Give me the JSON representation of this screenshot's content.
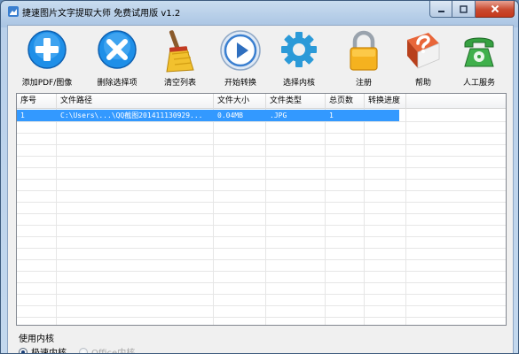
{
  "window": {
    "title": "捷速图片文字提取大师 免费试用版 v1.2",
    "controls": {
      "minimize": "─",
      "maximize": "□",
      "close": "✕"
    }
  },
  "toolbar": {
    "items": [
      {
        "id": "add",
        "label": "添加PDF/图像",
        "icon": "plus-circle-icon",
        "color": "#1e90ff"
      },
      {
        "id": "delete",
        "label": "删除选择项",
        "icon": "x-circle-icon",
        "color": "#1e90ff"
      },
      {
        "id": "clear",
        "label": "清空列表",
        "icon": "broom-icon",
        "color": "#e0b020"
      },
      {
        "id": "start",
        "label": "开始转换",
        "icon": "play-icon",
        "color": "#3a7fd0"
      },
      {
        "id": "kernel",
        "label": "选择内核",
        "icon": "gear-icon",
        "color": "#2a9ad8"
      },
      {
        "id": "register",
        "label": "注册",
        "icon": "lock-icon",
        "color": "#f0a820"
      },
      {
        "id": "help",
        "label": "帮助",
        "icon": "help-book-icon",
        "color": "#d8542a"
      },
      {
        "id": "service",
        "label": "人工服务",
        "icon": "telephone-icon",
        "color": "#3aa040"
      }
    ]
  },
  "file_table": {
    "columns": [
      "序号",
      "文件路径",
      "文件大小",
      "文件类型",
      "总页数",
      "转换进度"
    ],
    "rows": [
      {
        "index": "1",
        "path": "C:\\Users\\...\\QQ截图201411130929...",
        "size": "0.04MB",
        "type": ".JPG",
        "pages": "1",
        "progress": ""
      }
    ],
    "selected_row": 0
  },
  "kernel_group": {
    "label": "使用内核",
    "options": [
      {
        "label": "极速内核",
        "selected": true,
        "enabled": true
      },
      {
        "label": "Office内核",
        "selected": false,
        "enabled": false
      }
    ]
  }
}
